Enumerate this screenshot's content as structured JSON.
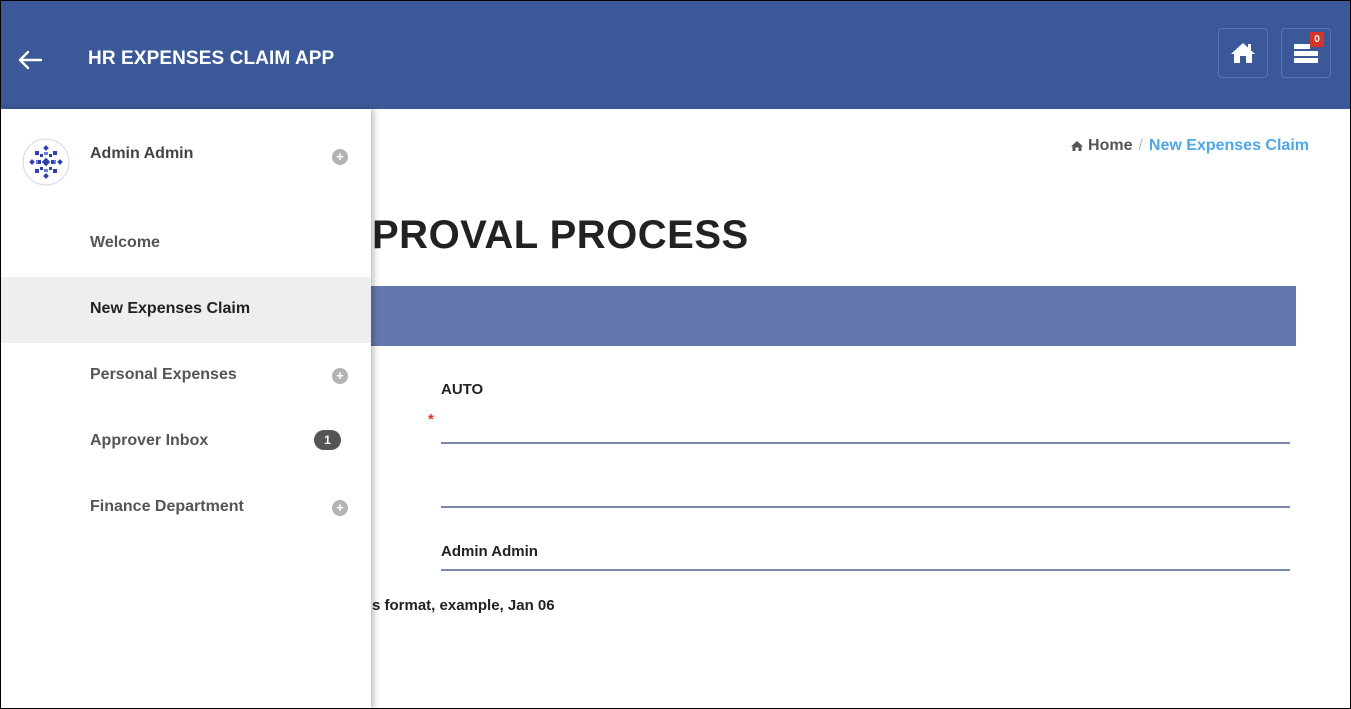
{
  "header": {
    "title": "HR EXPENSES CLAIM APP",
    "notification_count": "0",
    "accent_color": "#3b5998"
  },
  "sidebar": {
    "user_name": "Admin Admin",
    "items": [
      {
        "label": "Welcome",
        "icon": "none"
      },
      {
        "label": "New Expenses Claim",
        "icon": "none",
        "active": true
      },
      {
        "label": "Personal Expenses",
        "icon": "plus-circle-icon"
      },
      {
        "label": "Approver Inbox",
        "icon": "count-badge",
        "count": "1"
      },
      {
        "label": "Finance Department",
        "icon": "plus-circle-icon"
      }
    ]
  },
  "breadcrumb": {
    "home_label": "Home",
    "separator": "/",
    "current_label": "New Expenses Claim",
    "current_color": "#4fa7e8"
  },
  "main": {
    "heading_visible": "PROVAL PROCESS",
    "section_bar_color": "#6478ad",
    "fields": {
      "claim_number_value": "AUTO",
      "required_marker": "*",
      "requester_value": "Admin Admin"
    },
    "hint_visible": "s format, example, Jan 06"
  }
}
